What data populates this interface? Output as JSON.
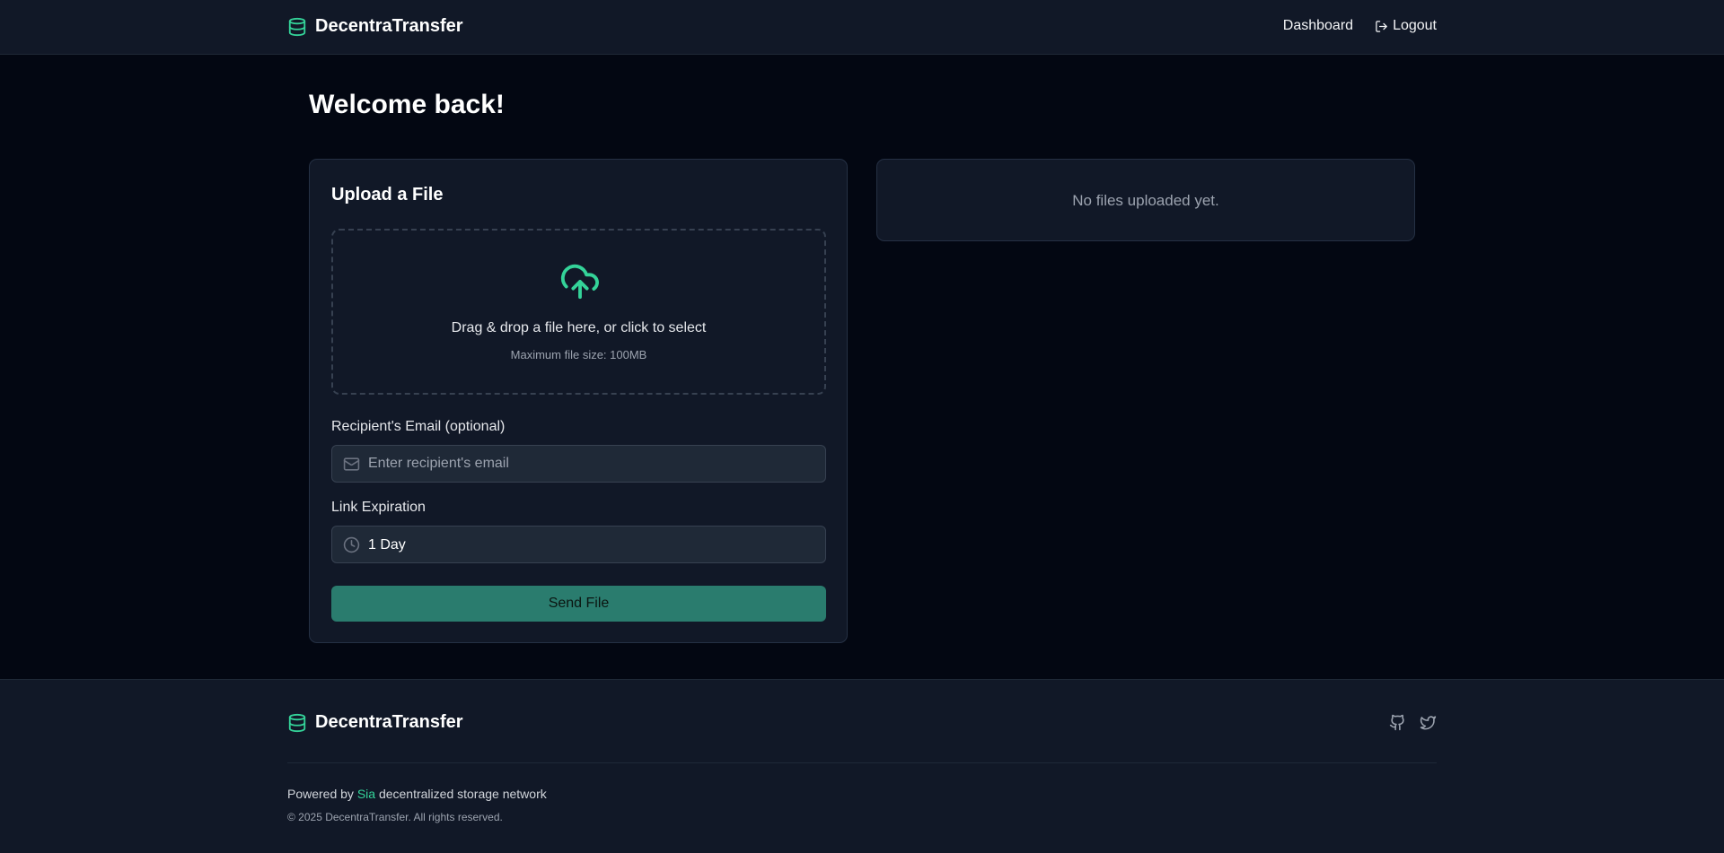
{
  "brand": {
    "name": "DecentraTransfer",
    "icon": "database-icon",
    "accent": "#34d399"
  },
  "nav": {
    "dashboard_label": "Dashboard",
    "logout_label": "Logout",
    "logout_icon": "logout-icon"
  },
  "main": {
    "welcome": "Welcome back!",
    "upload": {
      "title": "Upload a File",
      "dropzone_icon": "cloud-upload-icon",
      "dropzone_text": "Drag & drop a file here, or click to select",
      "dropzone_hint": "Maximum file size: 100MB",
      "email_label": "Recipient's Email (optional)",
      "email_placeholder": "Enter recipient's email",
      "email_value": "",
      "expiration_label": "Link Expiration",
      "expiration_value": "1 Day",
      "send_label": "Send File"
    },
    "files": {
      "empty_text": "No files uploaded yet."
    }
  },
  "footer": {
    "brand_name": "DecentraTransfer",
    "social_icons": [
      "github-icon",
      "twitter-icon"
    ],
    "powered_prefix": "Powered by",
    "powered_link": "Sia",
    "powered_suffix": "decentralized storage network",
    "copyright": "© 2025 DecentraTransfer. All rights reserved."
  }
}
